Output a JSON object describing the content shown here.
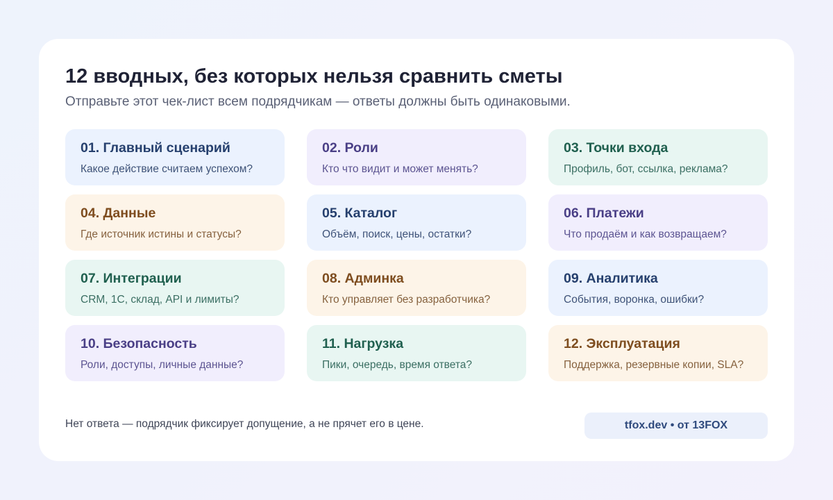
{
  "header": {
    "title": "12 вводных, без которых нельзя сравнить сметы",
    "subtitle": "Отправьте этот чек-лист всем подрядчикам — ответы должны быть одинаковыми."
  },
  "items": [
    {
      "title": "01. Главный сценарий",
      "desc": "Какое действие считаем успехом?",
      "color": "blue"
    },
    {
      "title": "02. Роли",
      "desc": "Кто что видит и может менять?",
      "color": "purple"
    },
    {
      "title": "03. Точки входа",
      "desc": "Профиль, бот, ссылка, реклама?",
      "color": "green"
    },
    {
      "title": "04. Данные",
      "desc": "Где источник истины и статусы?",
      "color": "orange"
    },
    {
      "title": "05. Каталог",
      "desc": "Объём, поиск, цены, остатки?",
      "color": "blue"
    },
    {
      "title": "06. Платежи",
      "desc": "Что продаём и как возвращаем?",
      "color": "purple"
    },
    {
      "title": "07. Интеграции",
      "desc": "CRM, 1С, склад, API и лимиты?",
      "color": "green"
    },
    {
      "title": "08. Админка",
      "desc": "Кто управляет без разработчика?",
      "color": "orange"
    },
    {
      "title": "09. Аналитика",
      "desc": "События, воронка, ошибки?",
      "color": "blue"
    },
    {
      "title": "10. Безопасность",
      "desc": "Роли, доступы, личные данные?",
      "color": "purple"
    },
    {
      "title": "11. Нагрузка",
      "desc": "Пики, очередь, время ответа?",
      "color": "green"
    },
    {
      "title": "12. Эксплуатация",
      "desc": "Поддержка, резервные копии, SLA?",
      "color": "orange"
    }
  ],
  "footer": {
    "note": "Нет ответа — подрядчик фиксирует допущение, а не прячет его в цене.",
    "badge": "tfox.dev • от 13FOX"
  },
  "colors": {
    "blue": "#ebf2fe",
    "purple": "#f1eefd",
    "green": "#e8f6f2",
    "orange": "#fdf4e8"
  }
}
